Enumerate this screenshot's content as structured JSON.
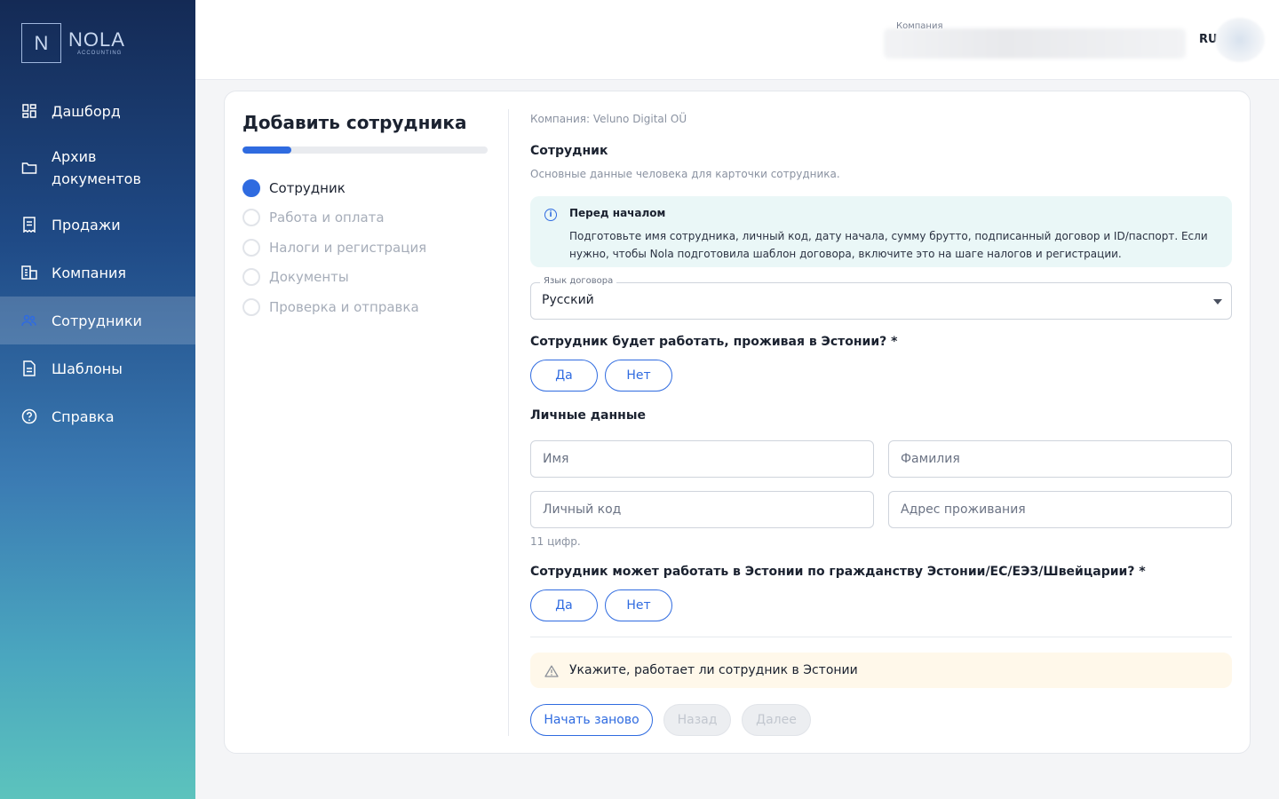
{
  "brand": {
    "initial": "N",
    "name": "NOLA",
    "sub": "ACCOUNTING"
  },
  "sidebar": {
    "items": [
      {
        "label": "Дашборд",
        "icon": "dashboard-icon",
        "active": false
      },
      {
        "label": "Архив документов",
        "icon": "folder-icon",
        "active": false
      },
      {
        "label": "Продажи",
        "icon": "receipt-icon",
        "active": false
      },
      {
        "label": "Компания",
        "icon": "building-icon",
        "active": false
      },
      {
        "label": "Сотрудники",
        "icon": "people-icon",
        "active": true
      },
      {
        "label": "Шаблоны",
        "icon": "document-icon",
        "active": false
      },
      {
        "label": "Справка",
        "icon": "help-icon",
        "active": false
      }
    ]
  },
  "header": {
    "company_label": "Компания",
    "language": "RU"
  },
  "wizard": {
    "title": "Добавить сотрудника",
    "progress": 0.2,
    "steps": [
      {
        "label": "Сотрудник",
        "active": true
      },
      {
        "label": "Работа и оплата",
        "active": false
      },
      {
        "label": "Налоги и регистрация",
        "active": false
      },
      {
        "label": "Документы",
        "active": false
      },
      {
        "label": "Проверка и отправка",
        "active": false
      }
    ]
  },
  "form": {
    "company_line": "Компания: Veluno Digital OÜ",
    "section_title": "Сотрудник",
    "section_sub": "Основные данные человека для карточки сотрудника.",
    "info": {
      "title": "Перед началом",
      "text": "Подготовьте имя сотрудника, личный код, дату начала, сумму брутто, подписанный договор и ID/паспорт. Если нужно, чтобы Nola подготовила шаблон договора, включите это на шаге налогов и регистрации."
    },
    "contract_language": {
      "label": "Язык договора",
      "value": "Русский"
    },
    "question_residence": "Сотрудник будет работать, проживая в Эстонии? *",
    "yes_label": "Да",
    "no_label": "Нет",
    "personal_title": "Личные данные",
    "first_name_placeholder": "Имя",
    "last_name_placeholder": "Фамилия",
    "personal_code_placeholder": "Личный код",
    "address_placeholder": "Адрес проживания",
    "personal_code_hint": "11 цифр.",
    "question_citizenship": "Сотрудник может работать в Эстонии по гражданству Эстонии/ЕС/ЕЭЗ/Швейцарии? *",
    "warning": "Укажите, работает ли сотрудник в Эстонии",
    "buttons": {
      "restart": "Начать заново",
      "back": "Назад",
      "next": "Далее"
    }
  },
  "colors": {
    "accent": "#2f6be0",
    "info_bg": "#eaf7f7",
    "warning_bg": "#fff8ea"
  }
}
